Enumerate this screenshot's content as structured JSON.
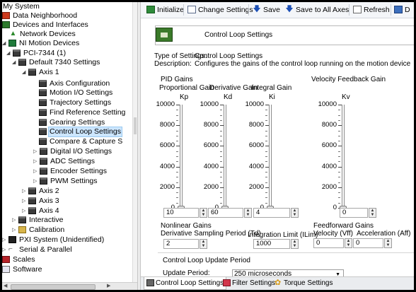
{
  "tree": {
    "items": [
      {
        "label": "My System",
        "icon": "system-icon",
        "expand": "",
        "depth": 0
      },
      {
        "label": "Data Neighborhood",
        "icon": "data-neighborhood-icon",
        "expand": "",
        "depth": 0
      },
      {
        "label": "Devices and Interfaces",
        "icon": "devices-icon",
        "expand": "",
        "depth": 0
      },
      {
        "label": "Network Devices",
        "icon": "network-icon",
        "expand": "",
        "depth": 1
      },
      {
        "label": "NI Motion Devices",
        "icon": "motion-icon",
        "expand": "◢",
        "depth": 0
      },
      {
        "label": "PCI-7344 (1)",
        "icon": "board-icon",
        "expand": "◢",
        "depth": 1
      },
      {
        "label": "Default 7340 Settings",
        "icon": "settings-icon",
        "expand": "◢",
        "depth": 2
      },
      {
        "label": "Axis 1",
        "icon": "board-icon",
        "expand": "◢",
        "depth": 3
      },
      {
        "label": "Axis Configuration",
        "icon": "board-icon",
        "expand": "",
        "depth": 4
      },
      {
        "label": "Motion I/O Settings",
        "icon": "board-icon",
        "expand": "",
        "depth": 4
      },
      {
        "label": "Trajectory Settings",
        "icon": "board-icon",
        "expand": "",
        "depth": 4
      },
      {
        "label": "Find Reference Setting",
        "icon": "board-icon",
        "expand": "",
        "depth": 4
      },
      {
        "label": "Gearing Settings",
        "icon": "board-icon",
        "expand": "",
        "depth": 4
      },
      {
        "label": "Control Loop Settings",
        "icon": "board-icon",
        "expand": "",
        "depth": 4,
        "selected": true
      },
      {
        "label": "Compare & Capture S",
        "icon": "board-icon",
        "expand": "",
        "depth": 4
      },
      {
        "label": "Digital I/O Settings",
        "icon": "board-icon",
        "expand": "▷",
        "depth": 4
      },
      {
        "label": "ADC Settings",
        "icon": "board-icon",
        "expand": "▷",
        "depth": 4
      },
      {
        "label": "Encoder Settings",
        "icon": "board-icon",
        "expand": "▷",
        "depth": 4
      },
      {
        "label": "PWM Settings",
        "icon": "board-icon",
        "expand": "▷",
        "depth": 4
      },
      {
        "label": "Axis 2",
        "icon": "board-icon",
        "expand": "▷",
        "depth": 3
      },
      {
        "label": "Axis 3",
        "icon": "board-icon",
        "expand": "▷",
        "depth": 3
      },
      {
        "label": "Axis 4",
        "icon": "board-icon",
        "expand": "▷",
        "depth": 3
      },
      {
        "label": "Interactive",
        "icon": "board-icon",
        "expand": "▷",
        "depth": 2
      },
      {
        "label": "Calibration",
        "icon": "folder-icon",
        "expand": "▷",
        "depth": 2
      },
      {
        "label": "PXI System (Unidentified)",
        "icon": "pxi-icon",
        "expand": "▷",
        "depth": 0
      },
      {
        "label": "Serial & Parallel",
        "icon": "serial-icon",
        "expand": "▷",
        "depth": 0
      },
      {
        "label": "Scales",
        "icon": "scales-icon",
        "expand": "",
        "depth": 0
      },
      {
        "label": "Software",
        "icon": "software-icon",
        "expand": "",
        "depth": 0
      }
    ],
    "hscroll_mid": "III"
  },
  "toolbar": {
    "initialize": "Initialize",
    "change_settings": "Change Settings",
    "save": "Save",
    "save_all": "Save to All Axes",
    "refresh": "Refresh",
    "last_label": "D"
  },
  "heading": "Control Loop Settings",
  "info": {
    "type_key": "Type of Settings:",
    "type_val": "Control Loop Settings",
    "desc_key": "Description:",
    "desc_val": "Configures the gains of the control loop running on the motion device"
  },
  "pid": {
    "title": "PID Gains",
    "columns": [
      {
        "name": "Proportional Gain",
        "short": "Kp",
        "value": "10"
      },
      {
        "name": "Derivative Gain",
        "short": "Kd",
        "value": "60"
      },
      {
        "name": "Integral Gain",
        "short": "Ki",
        "value": "4"
      }
    ],
    "ticks": [
      "10000",
      "8000",
      "6000",
      "4000",
      "2000",
      "0"
    ]
  },
  "velocity": {
    "title": "Velocity Feedback Gain",
    "short": "Kv",
    "value": "0"
  },
  "nonlinear": {
    "title": "Nonlinear Gains",
    "derivative_period_label": "Derivative Sampling Period (Td)",
    "derivative_period_value": "2",
    "integration_limit_label": "Integration Limit (ILim)",
    "integration_limit_value": "1000"
  },
  "feedforward": {
    "title": "Feedforward Gains",
    "velocity_label": "Velocity (Vff)",
    "velocity_value": "0",
    "accel_label": "Acceleration (Aff)",
    "accel_value": "0"
  },
  "update": {
    "title": "Control Loop Update Period",
    "label": "Update Period:",
    "value": "250 microseconds"
  },
  "bottom_tabs": [
    {
      "label": "Control Loop Settings",
      "icon": "control-loop-icon"
    },
    {
      "label": "Filter Settings",
      "icon": "filter-icon"
    },
    {
      "label": "Torque Settings",
      "icon": "torque-icon"
    }
  ]
}
